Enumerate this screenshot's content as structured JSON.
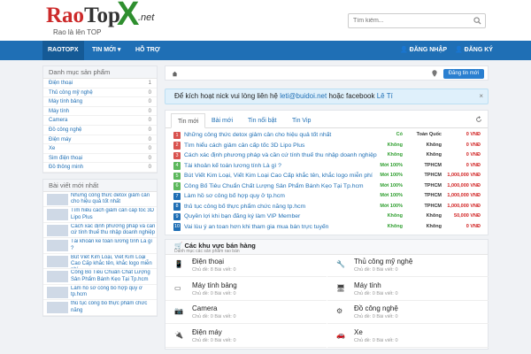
{
  "header": {
    "logo_main_left": "Rao",
    "logo_main_mid": "Top",
    "logo_x": "X",
    "logo_net": ".net",
    "logo_tagline": "Rao là lên TOP",
    "search_placeholder": "Tìm kiếm..."
  },
  "nav": {
    "items": [
      "RAOTOPX",
      "TIN MỚI",
      "HỖ TRỢ"
    ],
    "login": "ĐĂNG NHẬP",
    "register": "ĐĂNG KÝ",
    "brand_color": "#1f6fb5"
  },
  "sidebar": {
    "cat_title": "Danh mục sản phẩm",
    "categories": [
      {
        "name": "Điện thoại",
        "count": "1"
      },
      {
        "name": "Thủ công mỹ nghệ",
        "count": "0"
      },
      {
        "name": "Máy tính bảng",
        "count": "0"
      },
      {
        "name": "Máy tính",
        "count": "0"
      },
      {
        "name": "Camera",
        "count": "0"
      },
      {
        "name": "Đồ công nghệ",
        "count": "0"
      },
      {
        "name": "Điện máy",
        "count": "0"
      },
      {
        "name": "Xe",
        "count": "0"
      },
      {
        "name": "Sim điện thoại",
        "count": "0"
      },
      {
        "name": "Đồ thông minh",
        "count": "0"
      }
    ],
    "new_title": "Bài viết mới nhất",
    "new_posts": [
      "Những công thức detox giảm cân cho hiệu quả tốt nhất",
      "Tìm hiểu cách giảm cân cấp tốc 3D Lipo Plus",
      "Cách xác định phương pháp và cần cứ tính thuế thu nhập doanh nghiệp",
      "Tài khoản kế toán lương tính Là gì ?",
      "Bút Viết Kim Loại, Viết Kim Loại Cao Cấp khắc tên, khắc logo miễn phí",
      "Công Bố Tiêu Chuẩn Chất Lượng Sản Phẩm Bánh Kẹo Tại Tp.hcm",
      "Làm hồ sơ công bố hợp quy ở tp.hcm",
      "thủ tục công bố thực phẩm chức năng"
    ]
  },
  "main": {
    "post_button": "Đăng tin mới",
    "notice_text": "Để kích hoạt nick vui lòng liên hệ ",
    "notice_email": "leti@buidoi.net",
    "notice_mid": " hoặc facebook ",
    "notice_fb": "Lê Tí",
    "notice_close": "×",
    "tabs": [
      "Tin mới",
      "Bài mới",
      "Tin nổi bật",
      "Tin Vip"
    ],
    "listings": [
      {
        "n": "1",
        "title": "Những công thức detox giảm cân cho hiệu quả tốt nhất",
        "gia": "Có",
        "loc": "Toàn Quốc",
        "price": "0 VNĐ",
        "color": "#d9534f",
        "gcolor": "#2e9e2e"
      },
      {
        "n": "2",
        "title": "Tìm hiểu cách giảm cân cấp tốc 3D Lipo Plus",
        "gia": "Không",
        "loc": "Không",
        "price": "0 VNĐ",
        "color": "#d9534f",
        "gcolor": "#2e9e2e"
      },
      {
        "n": "3",
        "title": "Cách xác định phương pháp và cần cứ tính thuế thu nhập doanh nghiệp",
        "gia": "Không",
        "loc": "Không",
        "price": "0 VNĐ",
        "color": "#d9534f",
        "gcolor": "#2e9e2e"
      },
      {
        "n": "4",
        "title": "Tài khoản kế toán lương tính Là gì ?",
        "gia": "Mới 100%",
        "loc": "TPHCM",
        "price": "0 VNĐ",
        "color": "#5cb85c",
        "gcolor": "#2e9e2e"
      },
      {
        "n": "5",
        "title": "Bút Viết Kim Loại, Viết Kim Loại Cao Cấp khắc tên, khắc logo miễn phí",
        "gia": "Mới 100%",
        "loc": "TPHCM",
        "price": "1,000,000 VNĐ",
        "color": "#5cb85c",
        "gcolor": "#2e9e2e"
      },
      {
        "n": "6",
        "title": "Công Bố Tiêu Chuẩn Chất Lượng Sản Phẩm Bánh Kẹo Tại Tp.hcm",
        "gia": "Mới 100%",
        "loc": "TPHCM",
        "price": "1,000,000 VNĐ",
        "color": "#5cb85c",
        "gcolor": "#2e9e2e"
      },
      {
        "n": "7",
        "title": "Làm hồ sơ công bố hợp quy ở tp.hcm",
        "gia": "Mới 100%",
        "loc": "TPHCM",
        "price": "1,000,000 VNĐ",
        "color": "#1f6fb5",
        "gcolor": "#2e9e2e"
      },
      {
        "n": "8",
        "title": "thủ tục công bố thực phẩm chức năng tp.hcm",
        "gia": "Mới 100%",
        "loc": "TPHCM",
        "price": "1,000,000 VNĐ",
        "color": "#1f6fb5",
        "gcolor": "#2e9e2e"
      },
      {
        "n": "9",
        "title": "Quyền lợi khi bạn đăng ký làm VIP Member",
        "gia": "Không",
        "loc": "Không",
        "price": "50,000 VNĐ",
        "color": "#1f6fb5",
        "gcolor": "#2e9e2e"
      },
      {
        "n": "10",
        "title": "Vai lùu ý an toan hơn khi tham gia mua bán trực tuyến",
        "gia": "Không",
        "loc": "Không",
        "price": "0 VNĐ",
        "color": "#1f6fb5",
        "gcolor": "#2e9e2e"
      }
    ],
    "area_title": "Các khu vực bán hàng",
    "area_subtitle": "Danh mục các sản phẩm rao bán",
    "areas": [
      {
        "name": "Điện thoại",
        "stat": "Chủ đề: 8  Bài viết: 0"
      },
      {
        "name": "Thủ công mỹ nghệ",
        "stat": "Chủ đề: 0  Bài viết: 0"
      },
      {
        "name": "Máy tính bảng",
        "stat": "Chủ đề: 0  Bài viết: 0"
      },
      {
        "name": "Máy tính",
        "stat": "Chủ đề: 0  Bài viết: 0"
      },
      {
        "name": "Camera",
        "stat": "Chủ đề: 0  Bài viết: 0"
      },
      {
        "name": "Đồ công nghệ",
        "stat": "Chủ đề: 0  Bài viết: 0"
      },
      {
        "name": "Điện máy",
        "stat": "Chủ đề: 0  Bài viết: 0"
      },
      {
        "name": "Xe",
        "stat": "Chủ đề: 0  Bài viết: 0"
      }
    ]
  }
}
